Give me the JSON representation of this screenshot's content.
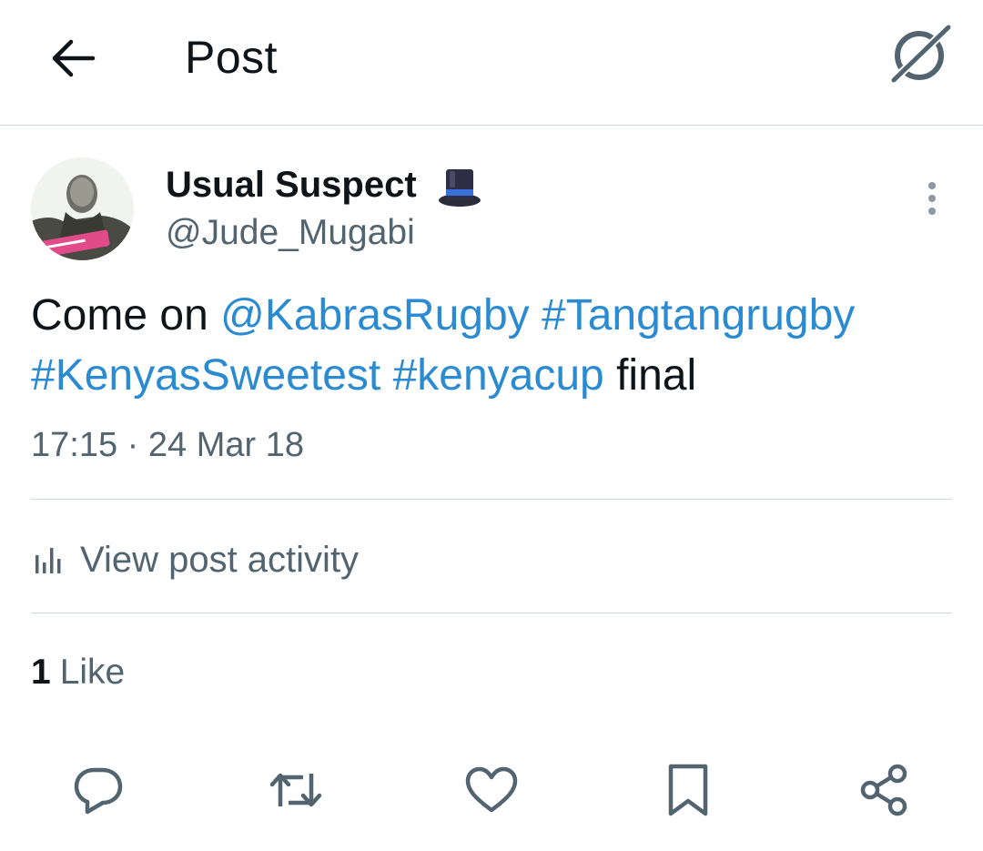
{
  "header": {
    "title": "Post",
    "back_icon": "arrow-left-icon",
    "grok_icon": "grok-icon"
  },
  "post": {
    "author_name": "Usual Suspect",
    "author_emoji": "top-hat-emoji",
    "author_handle": "@Jude_Mugabi",
    "text_segments": [
      {
        "text": "Come on ",
        "type": "text"
      },
      {
        "text": "@KabrasRugby",
        "type": "mention"
      },
      {
        "text": " ",
        "type": "text"
      },
      {
        "text": "#Tangtangrugby",
        "type": "hashtag"
      },
      {
        "text": " ",
        "type": "text"
      },
      {
        "text": "#KenyasSweetest",
        "type": "hashtag"
      },
      {
        "text": " ",
        "type": "text"
      },
      {
        "text": "#kenyacup",
        "type": "hashtag"
      },
      {
        "text": " final",
        "type": "text"
      }
    ],
    "timestamp": "17:15 · 24 Mar 18"
  },
  "activity": {
    "label": "View post activity",
    "icon": "bar-chart-icon"
  },
  "engagement": {
    "likes_count": "1",
    "likes_label": "Like"
  },
  "actions": [
    {
      "name": "reply",
      "icon": "reply-icon"
    },
    {
      "name": "repost",
      "icon": "repost-icon"
    },
    {
      "name": "like",
      "icon": "heart-icon"
    },
    {
      "name": "bookmark",
      "icon": "bookmark-icon"
    },
    {
      "name": "share",
      "icon": "share-icon"
    }
  ],
  "colors": {
    "link": "#2a8bd2",
    "text": "#0f1419",
    "secondary": "#536471",
    "divider": "#cfd9de"
  }
}
